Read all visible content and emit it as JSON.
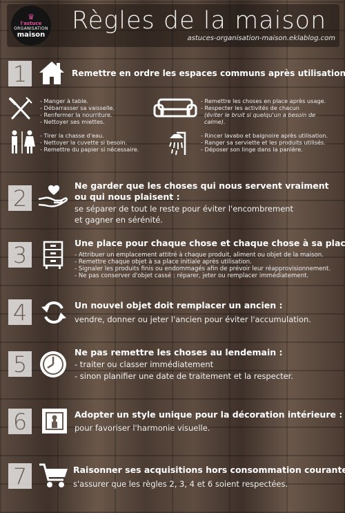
{
  "header": {
    "logo": {
      "line1": "l'astuce",
      "line2": "ORGANISATION",
      "line3": "maison"
    },
    "title": "Règles de la maison",
    "subtitle": "astuces-organisation-maison.eklablog.com"
  },
  "rules": [
    {
      "number": "1",
      "title": "Remettre en ordre les espaces communs après utilisation :",
      "groups": [
        {
          "icon": "cutlery-icon",
          "lines": [
            "- Manger à table.",
            "- Débarrasser sa vaisselle.",
            "- Renfermer la nourriture.",
            "- Nettoyer ses miettes."
          ]
        },
        {
          "icon": "sofa-icon",
          "lines": [
            "- Remettre les choses en place après usage.",
            "- Respecter les activités de chacun"
          ],
          "note": [
            "(éviter le bruit si quelqu'un a besoin de",
            "calme)."
          ]
        },
        {
          "icon": "restroom-icon",
          "lines": [
            "- Tirer la chasse d'eau.",
            "- Nettoyer la cuvette si besoin.",
            "- Remettre du papier si nécessaire."
          ]
        },
        {
          "icon": "shower-icon",
          "lines": [
            "- Rincer lavabo et baignoire après utilisation.",
            "- Ranger sa serviette et les produits utilisés.",
            "- Déposer son linge dans la panière."
          ]
        }
      ]
    },
    {
      "number": "2",
      "title_lines": [
        "Ne garder que les choses qui nous servent vraiment",
        "ou qui nous plaisent :"
      ],
      "desc_lines": [
        "se séparer de tout le reste pour éviter l'encombrement",
        "et gagner en sérénité."
      ]
    },
    {
      "number": "3",
      "title": "Une place pour chaque chose et chaque chose à sa place",
      "lines": [
        "- Attribuer un emplacement attitré à chaque produit, aliment ou objet de la maison.",
        "- Remettre chaque objet à sa place initiale après utilisation.",
        "- Signaler les produits finis ou endommagés afin de prévoir leur réapprovisionnement.",
        "- Ne pas conserver d'objet cassé : réparer, jeter ou remplacer immédiatement."
      ]
    },
    {
      "number": "4",
      "title": "Un nouvel objet doit remplacer un ancien :",
      "desc_lines": [
        "vendre, donner ou jeter l'ancien pour éviter l'accumulation."
      ]
    },
    {
      "number": "5",
      "title": "Ne pas remettre les choses au lendemain :",
      "desc_lines": [
        "- traiter ou classer immédiatement",
        "- sinon planifier une date de traitement et la respecter."
      ]
    },
    {
      "number": "6",
      "title": "Adopter un style unique pour la décoration intérieure :",
      "desc_lines": [
        "pour favoriser l'harmonie visuelle."
      ]
    },
    {
      "number": "7",
      "title": "Raisonner ses acquisitions hors consommation courante :",
      "desc_lines": [
        "s'assurer que les règles 2, 3, 4 et 6 soient respectées."
      ]
    }
  ],
  "colors": {
    "accent": "#e0529c",
    "text": "#ffffff",
    "number_box": "#ebebeb",
    "number_text": "#6a5a50"
  }
}
